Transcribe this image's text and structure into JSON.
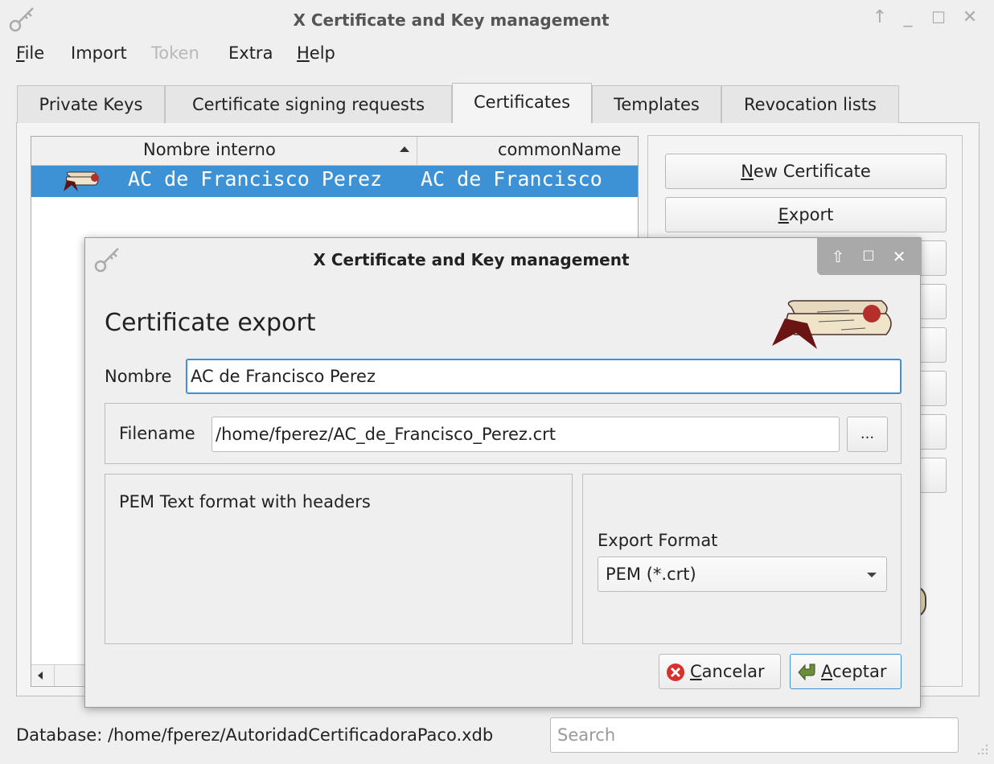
{
  "window": {
    "title": "X Certificate and Key management"
  },
  "menu": {
    "file": "File",
    "import": "Import",
    "token": "Token",
    "extra": "Extra",
    "help": "Help"
  },
  "tabs": [
    "Private Keys",
    "Certificate signing requests",
    "Certificates",
    "Templates",
    "Revocation lists"
  ],
  "active_tab": "Certificates",
  "list": {
    "columns": [
      "Nombre interno",
      "commonName"
    ],
    "rows": [
      {
        "internal_name": "AC de Francisco Perez",
        "common_name": "AC de Francisco"
      }
    ]
  },
  "side_buttons": {
    "new_certificate": "New Certificate",
    "export": "Export"
  },
  "status": {
    "database": "Database: /home/fperez/AutoridadCertificadoraPaco.xdb",
    "search_placeholder": "Search"
  },
  "dialog": {
    "title": "X Certificate and Key management",
    "heading": "Certificate export",
    "name_label": "Nombre",
    "name_value": "AC de Francisco Perez",
    "filename_label": "Filename",
    "filename_value": "/home/fperez/AC_de_Francisco_Perez.crt",
    "browse_label": "...",
    "format_description": "PEM Text format with headers",
    "export_format_label": "Export Format",
    "export_format_value": "PEM (*.crt)",
    "cancel_label": "Cancelar",
    "ok_label": "Aceptar"
  },
  "colors": {
    "selection": "#3d92d6",
    "focus": "#3d92d6",
    "cancel_icon": "#d9302c",
    "ok_icon": "#6a8f3a"
  }
}
